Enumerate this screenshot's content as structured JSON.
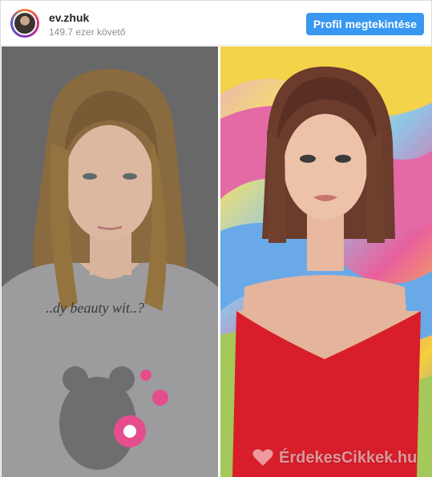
{
  "header": {
    "username": "ev.zhuk",
    "followers": "149.7 ezer követő",
    "profile_button_label": "Profil megtekintése",
    "accent_color": "#3897f0"
  },
  "post": {
    "watermark_text": "ÉrdekesCikkek.hu",
    "shirt_text": "..dy beauty wit..?"
  },
  "icons": [
    "avatar",
    "heart-logo-icon"
  ]
}
